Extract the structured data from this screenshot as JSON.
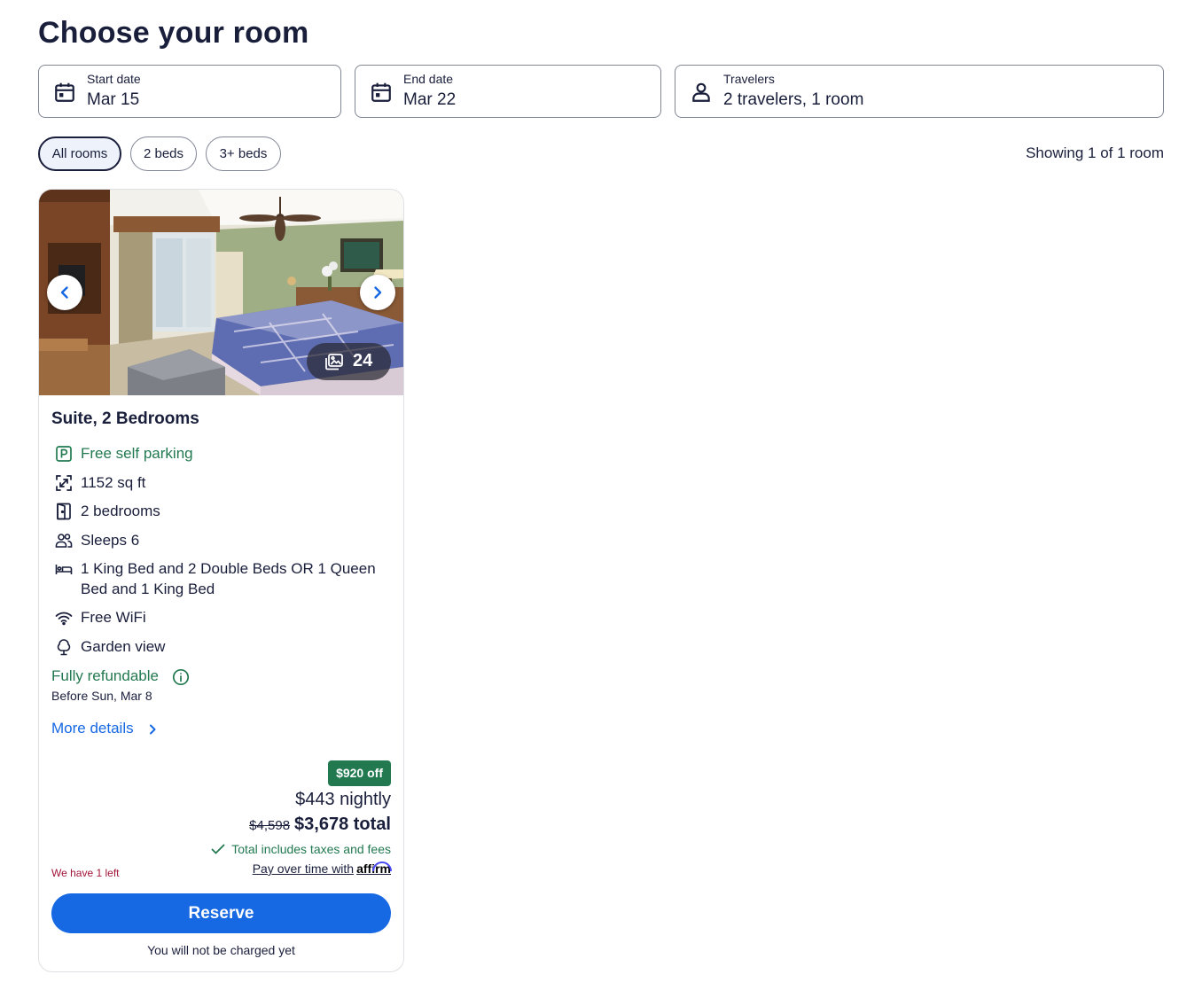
{
  "page_title": "Choose your room",
  "search": {
    "start_date": {
      "label": "Start date",
      "value": "Mar 15",
      "icon": "calendar-icon"
    },
    "end_date": {
      "label": "End date",
      "value": "Mar 22",
      "icon": "calendar-icon"
    },
    "travelers": {
      "label": "Travelers",
      "value": "2 travelers, 1 room",
      "icon": "person-icon"
    }
  },
  "filters": {
    "chips": [
      {
        "label": "All rooms",
        "active": true
      },
      {
        "label": "2 beds",
        "active": false
      },
      {
        "label": "3+ beds",
        "active": false
      }
    ],
    "showing_text": "Showing 1 of 1 room"
  },
  "room": {
    "photo_count": "24",
    "title": "Suite, 2 Bedrooms",
    "amenities": [
      {
        "icon": "parking-icon",
        "text": "Free self parking",
        "highlight": true
      },
      {
        "icon": "area-icon",
        "text": "1152 sq ft",
        "highlight": false
      },
      {
        "icon": "door-icon",
        "text": "2 bedrooms",
        "highlight": false
      },
      {
        "icon": "people-icon",
        "text": "Sleeps 6",
        "highlight": false
      },
      {
        "icon": "bed-icon",
        "text": "1 King Bed and 2 Double Beds OR 1 Queen Bed and 1 King Bed",
        "highlight": false
      },
      {
        "icon": "wifi-icon",
        "text": "Free WiFi",
        "highlight": false
      },
      {
        "icon": "tree-icon",
        "text": "Garden view",
        "highlight": false
      }
    ],
    "refund": {
      "label": "Fully refundable",
      "sub": "Before Sun, Mar 8"
    },
    "more_details": "More details",
    "price": {
      "discount_badge": "$920 off",
      "nightly": "$443 nightly",
      "original_total": "$4,598",
      "total": "$3,678 total",
      "taxes_note": "Total includes taxes and fees",
      "availability": "We have 1 left",
      "affirm_text": "Pay over time with",
      "affirm_brand": "affirm"
    },
    "reserve_label": "Reserve",
    "reserve_note": "You will not be charged yet"
  },
  "colors": {
    "primary": "#1668e3",
    "text": "#191e3b",
    "success": "#227950",
    "urgent": "#a2153a",
    "border": "#818594"
  }
}
